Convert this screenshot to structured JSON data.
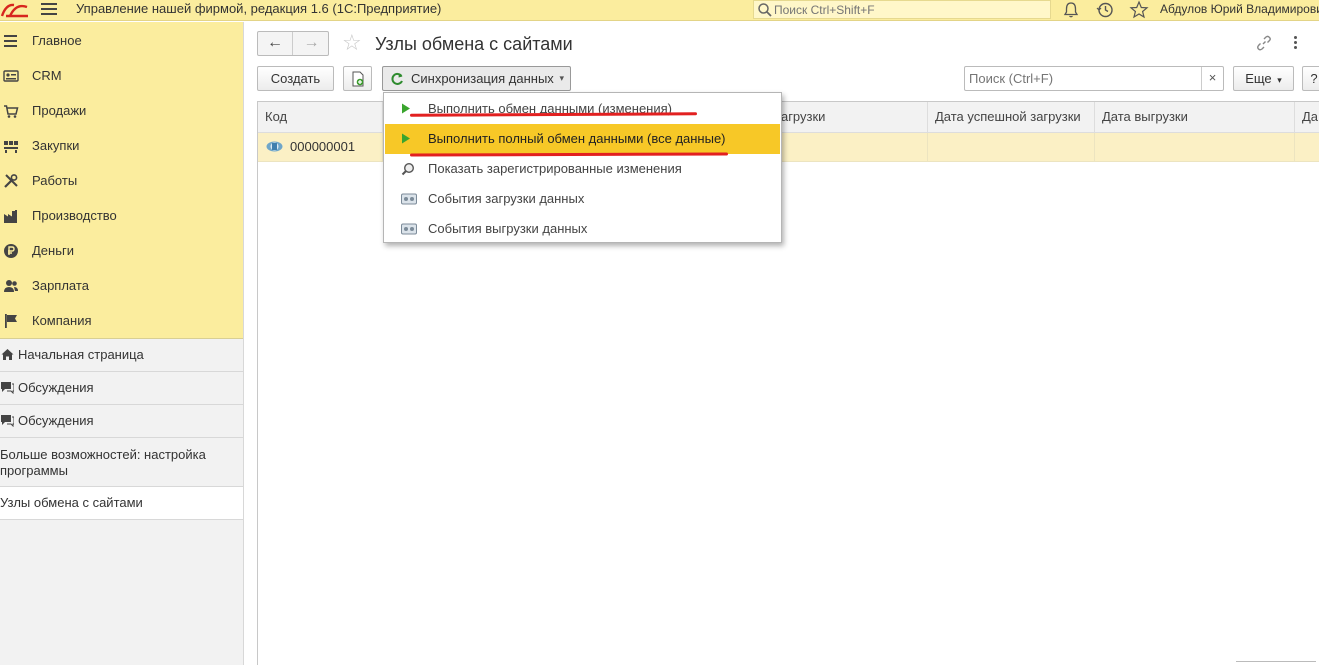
{
  "app": {
    "title": "Управление нашей фирмой, редакция 1.6  (1С:Предприятие)",
    "search_placeholder": "Поиск Ctrl+Shift+F",
    "user": "Абдулов Юрий Владимирович"
  },
  "sections": [
    {
      "label": "Главное",
      "icon": "menu-icon"
    },
    {
      "label": "CRM",
      "icon": "crm-icon"
    },
    {
      "label": "Продажи",
      "icon": "cart-icon"
    },
    {
      "label": "Закупки",
      "icon": "purchases-icon"
    },
    {
      "label": "Работы",
      "icon": "tools-icon"
    },
    {
      "label": "Производство",
      "icon": "factory-icon"
    },
    {
      "label": "Деньги",
      "icon": "money-icon"
    },
    {
      "label": "Зарплата",
      "icon": "people-icon"
    },
    {
      "label": "Компания",
      "icon": "flag-icon"
    }
  ],
  "open_windows": [
    {
      "label": "Начальная страница",
      "icon": "home-icon"
    },
    {
      "label": "Обсуждения",
      "icon": "chat-icon"
    },
    {
      "label": "Обсуждения",
      "icon": "chat-icon"
    },
    {
      "label": "Больше возможностей: настройка программы"
    },
    {
      "label": "Узлы обмена с сайтами",
      "active": true
    }
  ],
  "page": {
    "title": "Узлы обмена с сайтами"
  },
  "toolbar": {
    "create_label": "Создать",
    "sync_label": "Синхронизация данных",
    "search_placeholder": "Поиск (Ctrl+F)",
    "clear_label": "×",
    "more_label": "Еще",
    "help_label": "?"
  },
  "table": {
    "columns": [
      "Код",
      "",
      "загрузки",
      "Дата успешной загрузки",
      "Дата выгрузки",
      "Да"
    ],
    "rows": [
      {
        "code": "000000001"
      }
    ]
  },
  "sync_menu": {
    "items": [
      {
        "label": "Выполнить обмен данными (изменения)",
        "icon": "play-icon"
      },
      {
        "label": "Выполнить полный обмен данными (все данные)",
        "icon": "play-icon",
        "highlighted": true
      },
      {
        "label": "Показать зарегистрированные изменения",
        "icon": "magnifier-icon"
      },
      {
        "label": "События загрузки данных",
        "icon": "event-log-icon"
      },
      {
        "label": "События выгрузки данных",
        "icon": "event-log-icon"
      }
    ]
  },
  "colors": {
    "section_bg": "#fbed9e",
    "highlight": "#f7c827",
    "selected_row": "#fbf0c5",
    "annotation": "#e22020"
  }
}
